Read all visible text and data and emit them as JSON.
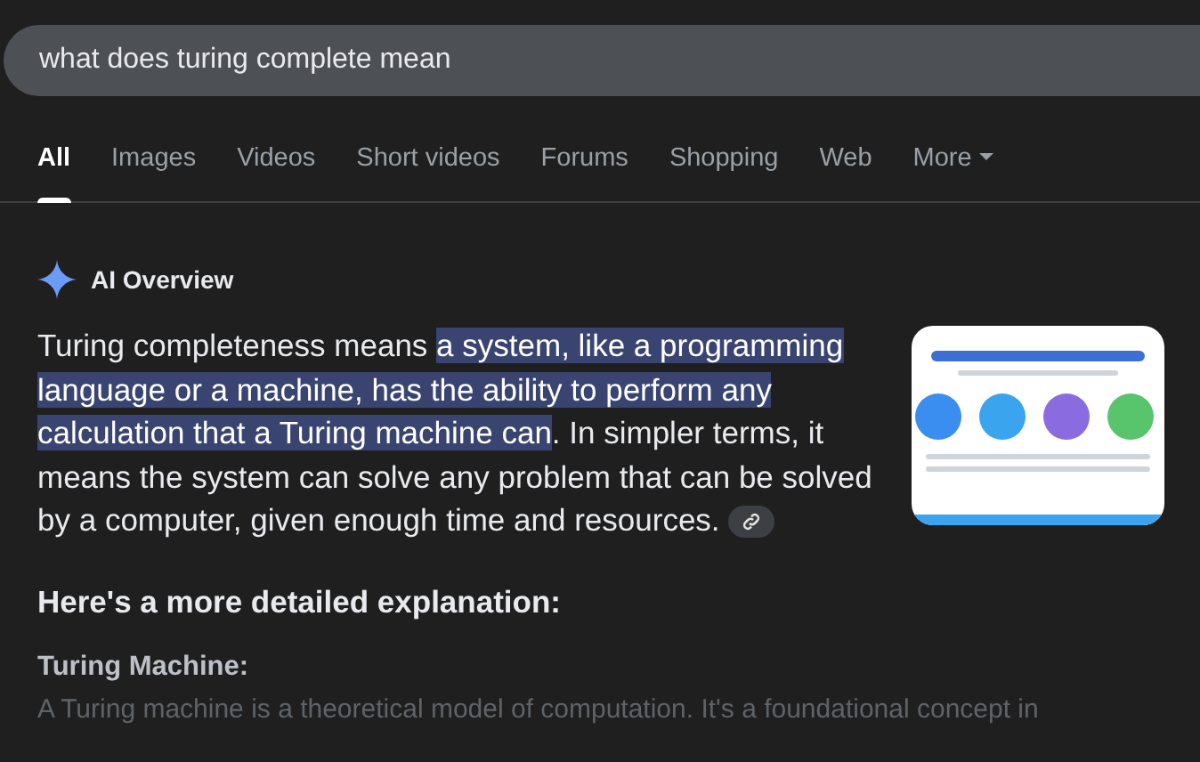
{
  "search": {
    "value": "what does turing complete mean"
  },
  "tabs": [
    {
      "label": "All",
      "selected": true
    },
    {
      "label": "Images",
      "selected": false
    },
    {
      "label": "Videos",
      "selected": false
    },
    {
      "label": "Short videos",
      "selected": false
    },
    {
      "label": "Forums",
      "selected": false
    },
    {
      "label": "Shopping",
      "selected": false
    },
    {
      "label": "Web",
      "selected": false
    },
    {
      "label": "More",
      "selected": false,
      "kind": "menu"
    }
  ],
  "ai_overview": {
    "title": "AI Overview",
    "summary": {
      "before": "Turing completeness means ",
      "highlighted": "a system, like a programming language or a machine, has the ability to perform any calculation that a Turing machine can",
      "after": ". In simpler terms, it means the system can solve any problem that can be solved by a computer, given enough time and resources."
    },
    "heading": "Here's a more detailed explanation:",
    "subheading": "Turing Machine:",
    "faded_text": "A Turing machine is a theoretical model of computation. It's a foundational concept in"
  }
}
